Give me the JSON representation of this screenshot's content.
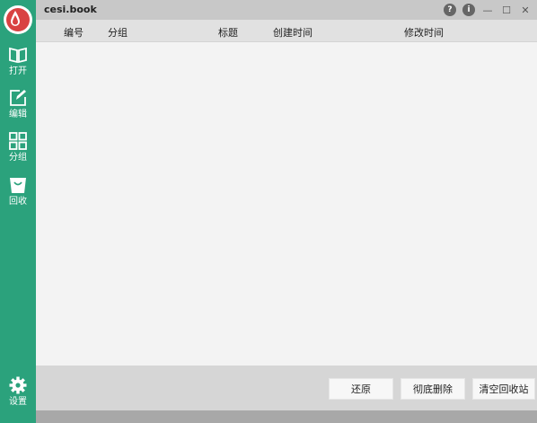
{
  "app": {
    "window_title": "cesi.book"
  },
  "window_controls": {
    "help": "?",
    "info": "i",
    "minimize": "—",
    "maximize": "☐",
    "close": "✕"
  },
  "sidebar": {
    "items": [
      {
        "label": "打开",
        "icon": "book-open-icon"
      },
      {
        "label": "编辑",
        "icon": "edit-icon"
      },
      {
        "label": "分组",
        "icon": "grid-icon"
      },
      {
        "label": "回收",
        "icon": "bin-icon"
      }
    ],
    "settings_label": "设置"
  },
  "table": {
    "columns": [
      "编号",
      "分组",
      "标题",
      "创建时间",
      "修改时间"
    ],
    "rows": []
  },
  "footer": {
    "restore_label": "还原",
    "delete_label": "彻底删除",
    "empty_label": "清空回收站"
  },
  "colors": {
    "sidebar": "#2ba27c",
    "logo": "#d94242",
    "titlebar": "#c8c8c8",
    "header": "#e1e1e1",
    "content": "#f3f3f3"
  }
}
